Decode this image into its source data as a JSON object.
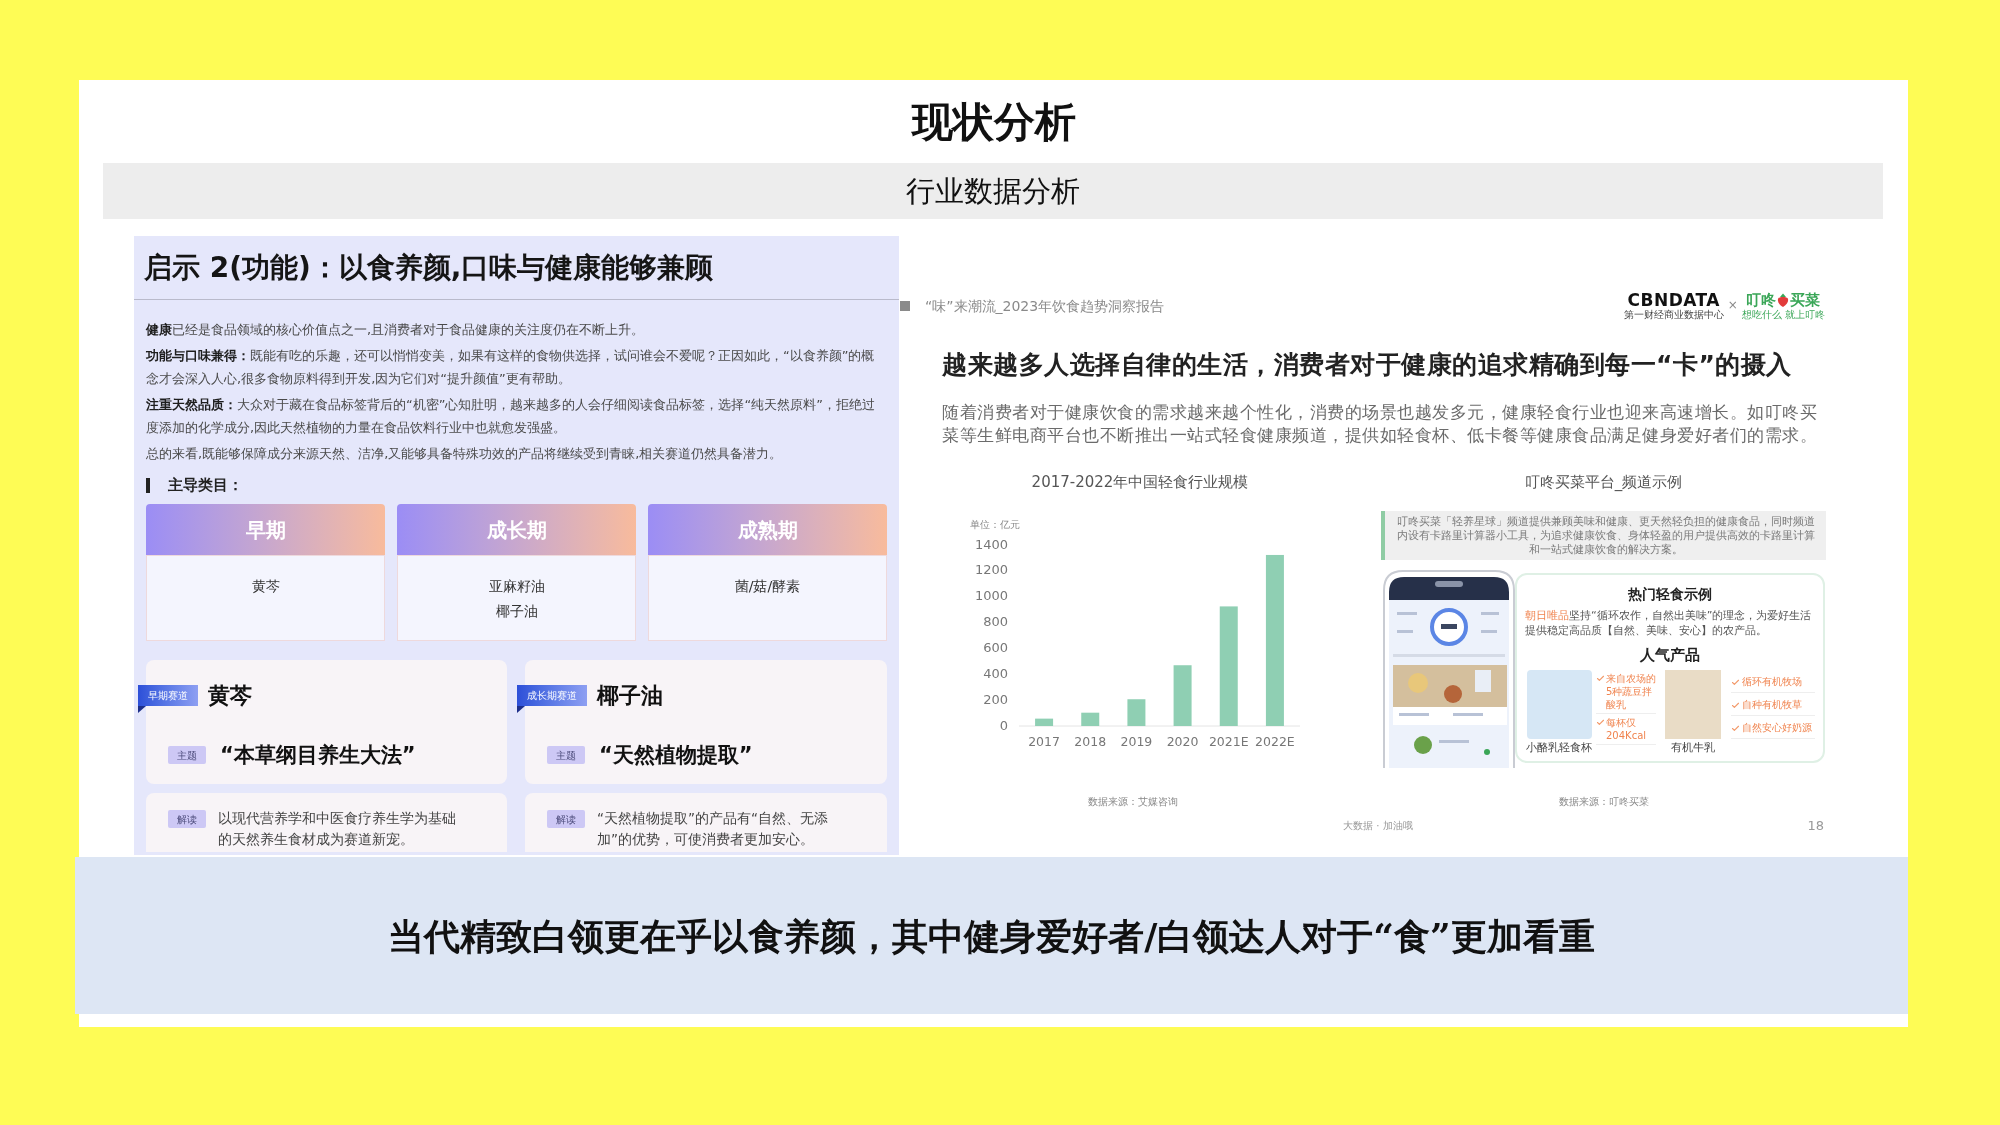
{
  "slide": {
    "title": "现状分析",
    "subtitle": "行业数据分析"
  },
  "left_panel": {
    "title": "启示 2(功能)：以食养颜,口味与健康能够兼顾",
    "paragraphs": [
      "**健康**已经是食品领域的核心价值点之一,且消费者对于食品健康的关注度仍在不断上升。",
      "**功能与口味兼得：**既能有吃的乐趣，还可以悄悄变美，如果有这样的食物供选择，试问谁会不爱呢？正因如此，“以食养颜”的概念才会深入人心,很多食物原料得到开发,因为它们对“提升颜值”更有帮助。",
      "**注重天然品质：**大众对于藏在食品标签背后的“机密”心知肚明，越来越多的人会仔细阅读食品标签，选择“纯天然原料”，拒绝过度添加的化学成分,因此天然植物的力量在食品饮料行业中也就愈发强盛。",
      "总的来看,既能够保障成分来源天然、洁净,又能够具备特殊功效的产品将继续受到青睐,相关赛道仍然具备潜力。"
    ],
    "section_heading": "主导类目：",
    "stages": [
      {
        "label": "早期",
        "items": [
          "黄芩"
        ]
      },
      {
        "label": "成长期",
        "items": [
          "亚麻籽油",
          "椰子油"
        ]
      },
      {
        "label": "成熟期",
        "items": [
          "菌/菇/酵素"
        ]
      }
    ],
    "tracks": [
      {
        "tag": "早期赛道",
        "name": "黄芩",
        "theme_label": "主题",
        "theme": "“本草纲目养生大法”",
        "note_label": "解读",
        "note": "以现代营养学和中医食疗养生学为基础的天然养生食材成为赛道新宠。"
      },
      {
        "tag": "成长期赛道",
        "name": "椰子油",
        "theme_label": "主题",
        "theme": "“天然植物提取”",
        "note_label": "解读",
        "note": "“天然植物提取”的产品有“自然、无添加”的优势，可使消费者更加安心。"
      }
    ]
  },
  "right_panel": {
    "report_label": "“味”来潮流_2023年饮食趋势洞察报告",
    "logo": {
      "left": "CBNDATA",
      "left_tagline": "第一财经商业数据中心",
      "separator": "×",
      "right_start": "叮咚",
      "right_end": "买菜",
      "right_tagline": "想吃什么 就上叮咚"
    },
    "heading": "越来越多人选择自律的生活，消费者对于健康的追求精确到每一“卡”的摄入",
    "body": "随着消费者对于健康饮食的需求越来越个性化，消费的场景也越发多元，健康轻食行业也迎来高速增长。如叮咚买菜等生鲜电商平台也不断推出一站式轻食健康频道，提供如轻食杯、低卡餐等健康食品满足健身爱好者们的需求。",
    "chart": {
      "chart_data": {
        "type": "bar",
        "title": "2017-2022年中国轻食行业规模",
        "ylabel": "单位：亿元",
        "categories": [
          "2017",
          "2018",
          "2019",
          "2020",
          "2021E",
          "2022E"
        ],
        "series": [
          {
            "color": "#8fcfb3",
            "values": [
              57,
              103,
              207,
              470,
              925,
              1323
            ]
          }
        ],
        "ylim": [
          0,
          1400
        ],
        "yticks": [
          0,
          200,
          400,
          600,
          800,
          1000,
          1200,
          1400
        ]
      },
      "source": "数据来源：艾媒咨询"
    },
    "platform": {
      "title": "叮咚买菜平台_频道示例",
      "description": "叮咚买菜「轻养星球」频道提供兼顾美味和健康、更天然轻负担的健康食品，同时频道内设有卡路里计算器小工具，为追求健康饮食、身体轻盈的用户提供高效的卡路里计算和一站式健康饮食的解决方案。",
      "card": {
        "title": "热门轻食示例",
        "text_highlight": "朝日唯品",
        "text": "坚持“循环农作，自然出美味”的理念，为爱好生活提供稳定高品质【自然、美味、安心】的农产品。",
        "products_heading": "人气产品",
        "products": [
          {
            "name": "小酪乳轻食杯",
            "points": [
              "来自农场的5种蔬豆拌酸乳",
              "每杯仅204Kcal"
            ]
          },
          {
            "name": "有机牛乳",
            "points": [
              "循环有机牧场",
              "自种有机牧草",
              "自然安心好奶源"
            ]
          }
        ]
      },
      "source": "数据来源：叮咚买菜"
    },
    "footer_note": "大数据 · 加油哦",
    "page_number": "18"
  },
  "banner": "当代精致白领更在乎以食养颜，其中健身爱好者/白领达人对于“食”更加看重"
}
